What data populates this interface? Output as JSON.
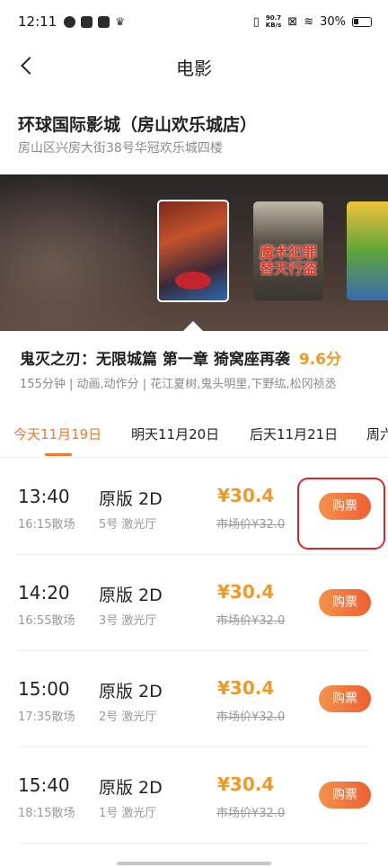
{
  "status_bar": {
    "time": "12:11",
    "net_speed_value": "90.7",
    "net_speed_unit": "KB/s",
    "battery": "30%"
  },
  "nav": {
    "title": "电影"
  },
  "cinema": {
    "name": "环球国际影城（房山欢乐城店）",
    "address": "房山区兴房大街38号华冠欢乐城四楼"
  },
  "posters": {
    "second_poster_text": "魔术犯罪 替天行盗"
  },
  "movie": {
    "title": "鬼灭之刃：无限城篇 第一章 猗窝座再袭",
    "score": "9.6分",
    "meta": "155分钟 | 动画,动作分 | 花江夏树,鬼头明里,下野纮,松冈祯丞"
  },
  "tabs": [
    {
      "label": "今天11月19日",
      "active": true
    },
    {
      "label": "明天11月20日",
      "active": false
    },
    {
      "label": "后天11月21日",
      "active": false
    },
    {
      "label": "周六",
      "active": false
    }
  ],
  "showtimes": [
    {
      "start": "13:40",
      "end": "16:15散场",
      "version": "原版 2D",
      "hall": "5号 激光厅",
      "price": "¥30.4",
      "market_price": "市场价¥32.0",
      "buy_label": "购票"
    },
    {
      "start": "14:20",
      "end": "16:55散场",
      "version": "原版 2D",
      "hall": "3号 激光厅",
      "price": "¥30.4",
      "market_price": "市场价¥32.0",
      "buy_label": "购票"
    },
    {
      "start": "15:00",
      "end": "17:35散场",
      "version": "原版 2D",
      "hall": "2号 激光厅",
      "price": "¥30.4",
      "market_price": "市场价¥32.0",
      "buy_label": "购票"
    },
    {
      "start": "15:40",
      "end": "18:15散场",
      "version": "原版 2D",
      "hall": "1号 激光厅",
      "price": "¥30.4",
      "market_price": "市场价¥32.0",
      "buy_label": "购票"
    }
  ],
  "colors": {
    "accent_orange": "#f07a2a",
    "price_orange": "#f09a24",
    "highlight_red": "#d9252a"
  }
}
